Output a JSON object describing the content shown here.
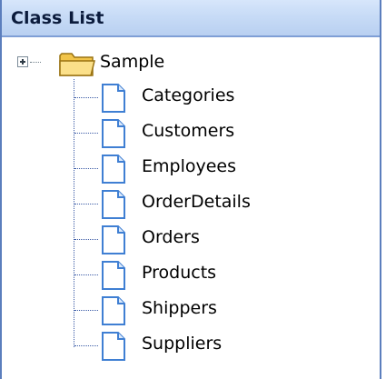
{
  "panel": {
    "title": "Class List"
  },
  "tree": {
    "root": {
      "label": "Sample",
      "icon": "folder-icon",
      "expander_icon": "expand-plus-icon"
    },
    "children": [
      {
        "label": "Categories",
        "icon": "document-icon"
      },
      {
        "label": "Customers",
        "icon": "document-icon"
      },
      {
        "label": "Employees",
        "icon": "document-icon"
      },
      {
        "label": "OrderDetails",
        "icon": "document-icon"
      },
      {
        "label": "Orders",
        "icon": "document-icon"
      },
      {
        "label": "Products",
        "icon": "document-icon"
      },
      {
        "label": "Shippers",
        "icon": "document-icon"
      },
      {
        "label": "Suppliers",
        "icon": "document-icon"
      }
    ]
  },
  "colors": {
    "header_bg": "#c7dbf6",
    "border": "#5b7ebd",
    "tree_line": "#3b5ba6",
    "folder": "#f5c84c",
    "document": "#4a86d6"
  }
}
